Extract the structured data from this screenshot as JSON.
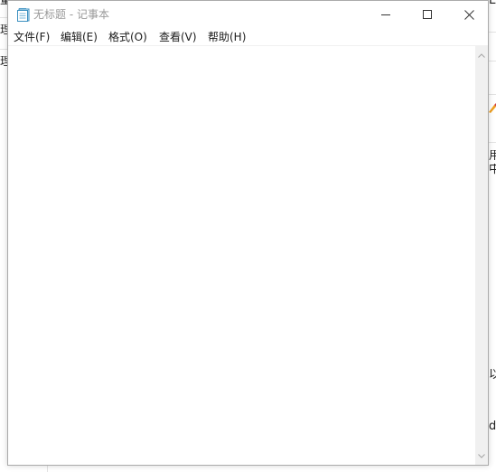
{
  "window": {
    "title": "无标题 - 记事本",
    "app_icon": "notepad-icon",
    "controls": {
      "minimize_icon": "minimize-icon",
      "maximize_icon": "maximize-icon",
      "close_icon": "close-icon"
    }
  },
  "menubar": {
    "items": [
      {
        "label": "文件(F)"
      },
      {
        "label": "编辑(E)"
      },
      {
        "label": "格式(O)"
      },
      {
        "label": "查看(V)"
      },
      {
        "label": "帮助(H)"
      }
    ]
  },
  "editor": {
    "value": ""
  },
  "scrollbar": {
    "up_icon": "scroll-up-arrow-icon",
    "down_icon": "scroll-down-arrow-icon"
  },
  "background": {
    "left_fragments": [
      "量",
      "理",
      "理"
    ],
    "right_fragments": [
      "E",
      "用",
      "中",
      "以",
      "d"
    ]
  },
  "colors": {
    "title_text": "#999999",
    "menu_text": "#1a1a1a",
    "scrollbar_track": "#f0f0f0",
    "window_border": "#aaaaaa"
  }
}
